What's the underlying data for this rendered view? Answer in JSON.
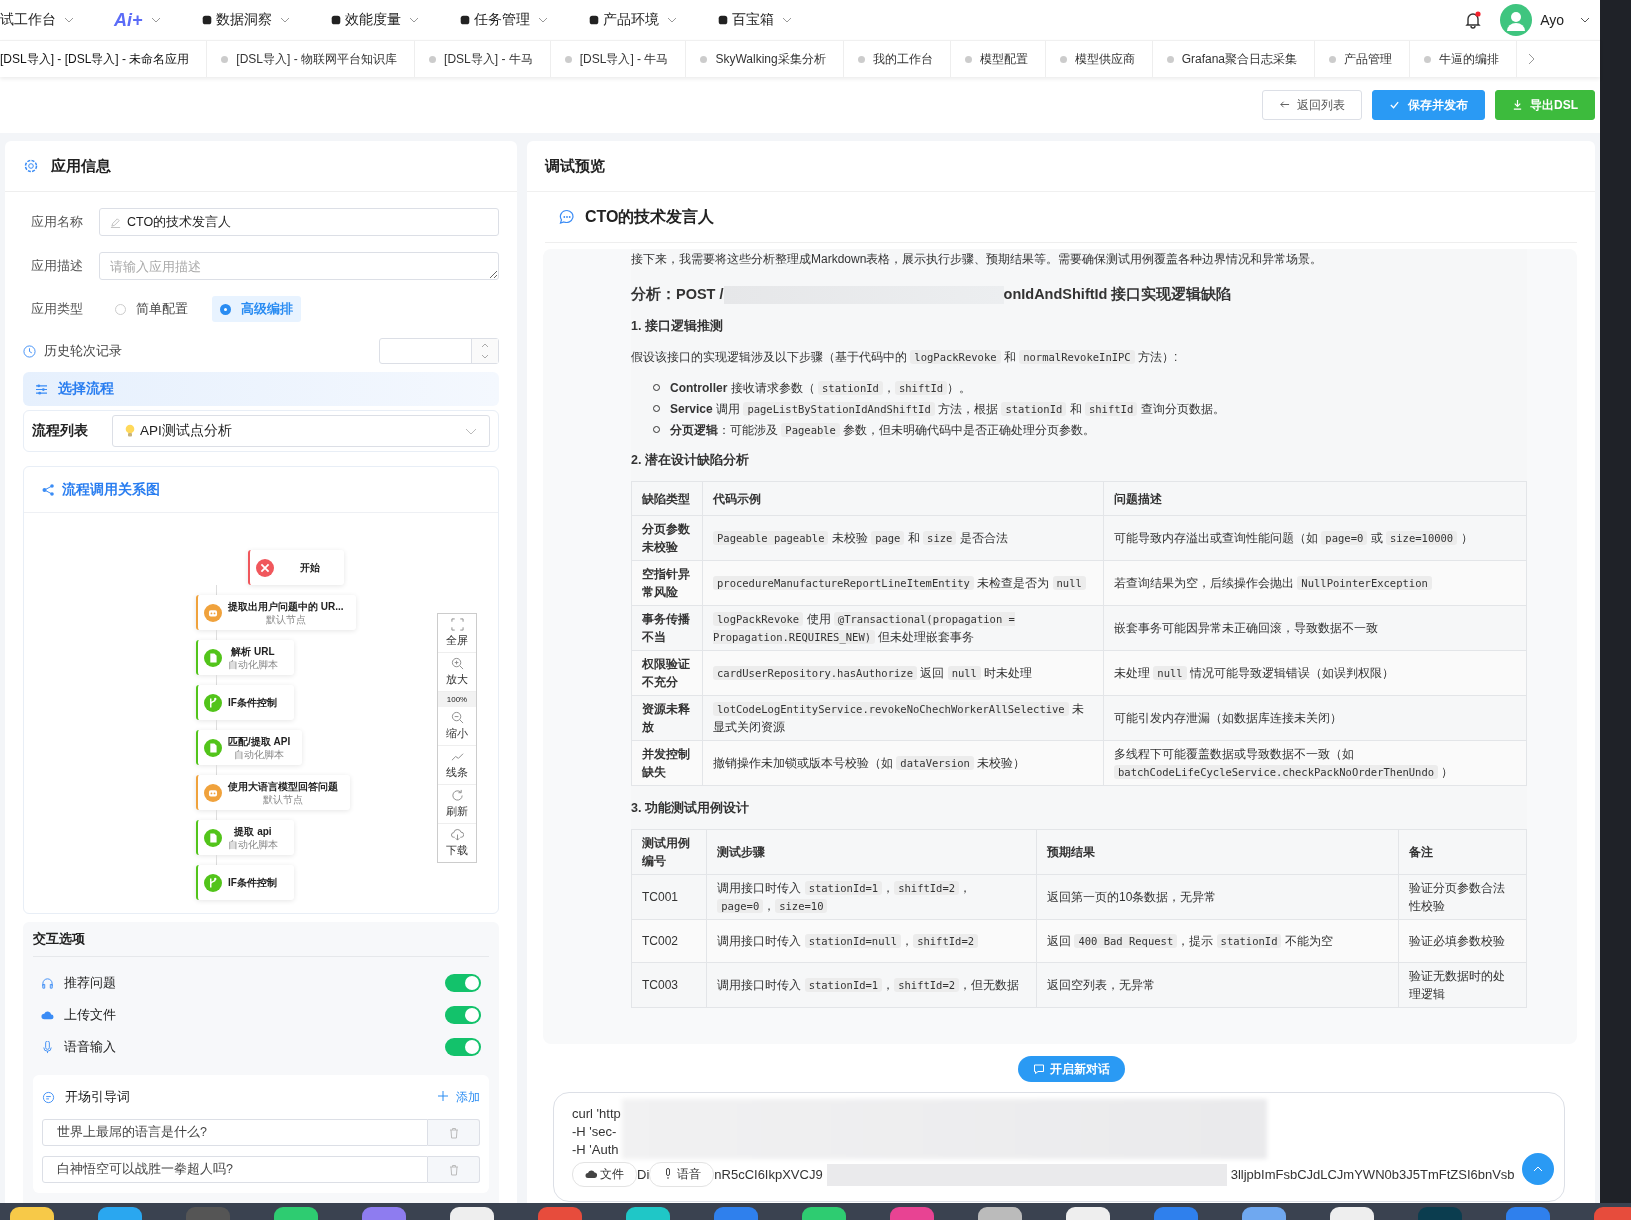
{
  "nav": {
    "items": [
      {
        "label": "试工作台",
        "kind": "menu"
      },
      {
        "label": "Ai+",
        "kind": "logo"
      },
      {
        "label": "数据洞察",
        "kind": "menu"
      },
      {
        "label": "效能度量",
        "kind": "menu"
      },
      {
        "label": "任务管理",
        "kind": "menu"
      },
      {
        "label": "产品环境",
        "kind": "menu"
      },
      {
        "label": "百宝箱",
        "kind": "menu"
      }
    ],
    "alert": true,
    "user": "Ayo"
  },
  "tabs": [
    {
      "label": "[DSL导入] - [DSL导入] - 未命名应用",
      "selected": true
    },
    {
      "label": "[DSL导入] - 物联网平台知识库",
      "selected": false
    },
    {
      "label": "[DSL导入] - 牛马",
      "selected": false
    },
    {
      "label": "[DSL导入] - 牛马",
      "selected": false
    },
    {
      "label": "SkyWalking采集分析",
      "selected": false
    },
    {
      "label": "我的工作台",
      "selected": false
    },
    {
      "label": "模型配置",
      "selected": false
    },
    {
      "label": "模型供应商",
      "selected": false
    },
    {
      "label": "Grafana聚合日志采集",
      "selected": false
    },
    {
      "label": "产品管理",
      "selected": false
    },
    {
      "label": "牛逼的编排",
      "selected": false
    }
  ],
  "actions": [
    {
      "label": "返回列表",
      "kind": "back"
    },
    {
      "label": "保存并发布",
      "kind": "publish"
    },
    {
      "label": "导出DSL",
      "kind": "export"
    }
  ],
  "app_info": {
    "title": "应用信息",
    "name": {
      "label": "应用名称",
      "value": "CTO的技术发言人"
    },
    "description": {
      "label": "应用描述",
      "placeholder": "请输入应用描述"
    },
    "type": {
      "label": "应用类型",
      "options": [
        {
          "label": "简单配置",
          "selected": false
        },
        {
          "label": "高级编排",
          "selected": true
        }
      ]
    },
    "history": {
      "label": "历史轮次记录"
    },
    "select_flow": {
      "title": "选择流程",
      "label": "流程列表",
      "value": "API测试点分析"
    },
    "graph": {
      "title": "流程调用关系图",
      "nodes": [
        {
          "title": "开始",
          "kind": "start"
        },
        {
          "title": "提取出用户问题中的 UR...",
          "subtitle": "默认节点",
          "kind": "bot"
        },
        {
          "title": "解析 URL",
          "subtitle": "自动化脚本",
          "kind": "script"
        },
        {
          "title": "IF条件控制",
          "kind": "branch"
        },
        {
          "title": "匹配/提取 API",
          "subtitle": "自动化脚本",
          "kind": "script"
        },
        {
          "title": "使用大语言模型回答问题",
          "subtitle": "默认节点",
          "kind": "bot"
        },
        {
          "title": "提取 api",
          "subtitle": "自动化脚本",
          "kind": "script"
        },
        {
          "title": "IF条件控制",
          "kind": "branch"
        }
      ],
      "tools": [
        {
          "label": "全屏",
          "kind": "fullscreen"
        },
        {
          "label": "放大",
          "kind": "zoom-in"
        },
        {
          "label": "100%",
          "kind": "level"
        },
        {
          "label": "缩小",
          "kind": "zoom-out"
        },
        {
          "label": "线条",
          "kind": "line"
        },
        {
          "label": "刷新",
          "kind": "refresh"
        },
        {
          "label": "下载",
          "kind": "download"
        }
      ]
    }
  },
  "interaction": {
    "title": "交互选项",
    "toggles": [
      {
        "label": "推荐问题",
        "kind": "headset",
        "on": true
      },
      {
        "label": "上传文件",
        "kind": "cloud",
        "on": true
      },
      {
        "label": "语音输入",
        "kind": "mic",
        "on": true
      }
    ],
    "openers": {
      "title": "开场引导词",
      "add": "添加",
      "items": [
        "世界上最屌的语言是什么?",
        "白神悟空可以战胜一拳超人吗?"
      ]
    }
  },
  "preview": {
    "title": "调试预览",
    "chat_title": "CTO的技术发言人",
    "intro": "接下来，我需要将这些分析整理成Markdown表格，展示执行步骤、预期结果等。需要确保测试用例覆盖各种边界情况和异常场景。",
    "heading": {
      "before": "分析：POST /",
      "after": "onIdAndShiftId 接口实现逻辑缺陷"
    },
    "s1": "1. 接口逻辑推测",
    "s1_text": [
      {
        "t": "假设该接口的实现逻辑涉及以下步骤（基于代码中的 "
      },
      {
        "c": "logPackRevoke"
      },
      {
        "t": " 和 "
      },
      {
        "c": "normalRevokeInIPC"
      },
      {
        "t": " 方法）:"
      }
    ],
    "bullets": [
      [
        {
          "b": "Controller"
        },
        {
          "t": " 接收请求参数（ "
        },
        {
          "c": "stationId"
        },
        {
          "t": "，"
        },
        {
          "c": "shiftId"
        },
        {
          "t": "）。"
        }
      ],
      [
        {
          "b": "Service"
        },
        {
          "t": " 调用 "
        },
        {
          "c": "pageListByStationIdAndShiftId"
        },
        {
          "t": " 方法，根据 "
        },
        {
          "c": "stationId"
        },
        {
          "t": " 和 "
        },
        {
          "c": "shiftId"
        },
        {
          "t": " 查询分页数据。"
        }
      ],
      [
        {
          "b": "分页逻辑"
        },
        {
          "t": "：可能涉及 "
        },
        {
          "c": "Pageable"
        },
        {
          "t": " 参数，但未明确代码中是否正确处理分页参数。"
        }
      ]
    ],
    "s2": "2. 潜在设计缺陷分析",
    "table1": {
      "columns": [
        "缺陷类型",
        "代码示例",
        "问题描述"
      ],
      "rows": [
        [
          [
            {
              "t": "分页参数未校验"
            }
          ],
          [
            {
              "c": "Pageable pageable"
            },
            {
              "t": " 未校验 "
            },
            {
              "c": "page"
            },
            {
              "t": " 和 "
            },
            {
              "c": "size"
            },
            {
              "t": " 是否合法"
            }
          ],
          [
            {
              "t": "可能导致内存溢出或查询性能问题（如 "
            },
            {
              "c": "page=0"
            },
            {
              "t": " 或 "
            },
            {
              "c": "size=10000"
            },
            {
              "t": " ）"
            }
          ]
        ],
        [
          [
            {
              "t": "空指针异常风险"
            }
          ],
          [
            {
              "c": "procedureManufactureReportLineItemEntity"
            },
            {
              "t": " 未检查是否为 "
            },
            {
              "c": "null"
            }
          ],
          [
            {
              "t": "若查询结果为空，后续操作会抛出 "
            },
            {
              "c": "NullPointerException"
            }
          ]
        ],
        [
          [
            {
              "t": "事务传播不当"
            }
          ],
          [
            {
              "c": "logPackRevoke"
            },
            {
              "t": " 使用 "
            },
            {
              "c": "@Transactional(propagation = Propagation.REQUIRES_NEW)"
            },
            {
              "t": " 但未处理嵌套事务"
            }
          ],
          [
            {
              "t": "嵌套事务可能因异常未正确回滚，导致数据不一致"
            }
          ]
        ],
        [
          [
            {
              "t": "权限验证不充分"
            }
          ],
          [
            {
              "c": "cardUserRepository.hasAuthorize"
            },
            {
              "t": " 返回 "
            },
            {
              "c": "null"
            },
            {
              "t": " 时未处理"
            }
          ],
          [
            {
              "t": "未处理 "
            },
            {
              "c": "null"
            },
            {
              "t": " 情况可能导致逻辑错误（如误判权限）"
            }
          ]
        ],
        [
          [
            {
              "t": "资源未释放"
            }
          ],
          [
            {
              "c": "lotCodeLogEntityService.revokeNoChechWorkerAllSelective"
            },
            {
              "t": " 未显式关闭资源"
            }
          ],
          [
            {
              "t": "可能引发内存泄漏（如数据库连接未关闭）"
            }
          ]
        ],
        [
          [
            {
              "t": "并发控制缺失"
            }
          ],
          [
            {
              "t": "撤销操作未加锁或版本号校验（如 "
            },
            {
              "c": "dataVersion"
            },
            {
              "t": " 未校验）"
            }
          ],
          [
            {
              "t": "多线程下可能覆盖数据或导致数据不一致（如 "
            },
            {
              "c": "batchCodeLifeCycleService.checkPackNoOrderThenUndo"
            },
            {
              "t": " ）"
            }
          ]
        ]
      ]
    },
    "s3": "3. 功能测试用例设计",
    "table2": {
      "columns": [
        "测试用例编号",
        "测试步骤",
        "预期结果",
        "备注"
      ],
      "rows": [
        [
          [
            {
              "t": "TC001"
            }
          ],
          [
            {
              "t": "调用接口时传入 "
            },
            {
              "c": "stationId=1"
            },
            {
              "t": "，"
            },
            {
              "c": "shiftId=2"
            },
            {
              "t": "，"
            },
            {
              "c": "page=0"
            },
            {
              "t": "，"
            },
            {
              "c": "size=10"
            }
          ],
          [
            {
              "t": "返回第一页的10条数据，无异常"
            }
          ],
          [
            {
              "t": "验证分页参数合法性校验"
            }
          ]
        ],
        [
          [
            {
              "t": "TC002"
            }
          ],
          [
            {
              "t": "调用接口时传入 "
            },
            {
              "c": "stationId=null"
            },
            {
              "t": "，"
            },
            {
              "c": "shiftId=2"
            }
          ],
          [
            {
              "t": "返回 "
            },
            {
              "c": "400 Bad Request"
            },
            {
              "t": "，提示 "
            },
            {
              "c": "stationId"
            },
            {
              "t": " 不能为空"
            }
          ],
          [
            {
              "t": "验证必填参数校验"
            }
          ]
        ],
        [
          [
            {
              "t": "TC003"
            }
          ],
          [
            {
              "t": "调用接口时传入 "
            },
            {
              "c": "stationId=1"
            },
            {
              "t": "，"
            },
            {
              "c": "shiftId=2"
            },
            {
              "t": "，但无数据"
            }
          ],
          [
            {
              "t": "返回空列表，无异常"
            }
          ],
          [
            {
              "t": "验证无数据时的处理逻辑"
            }
          ]
        ]
      ]
    },
    "new_chat": "开启新对话",
    "input": {
      "lines": [
        "curl 'http",
        "-H 'sec-",
        "-H 'Auth"
      ],
      "last_line": {
        "before": "Di",
        "middle": "nR5cCI6IkpXVCJ9",
        "after": "3lljpbImFsbCJdLCJmYWN0b3J5TmFtZSI6bnVsb"
      },
      "attach": [
        {
          "label": "文件",
          "kind": "file"
        },
        {
          "label": "语音",
          "kind": "voice"
        }
      ]
    }
  }
}
